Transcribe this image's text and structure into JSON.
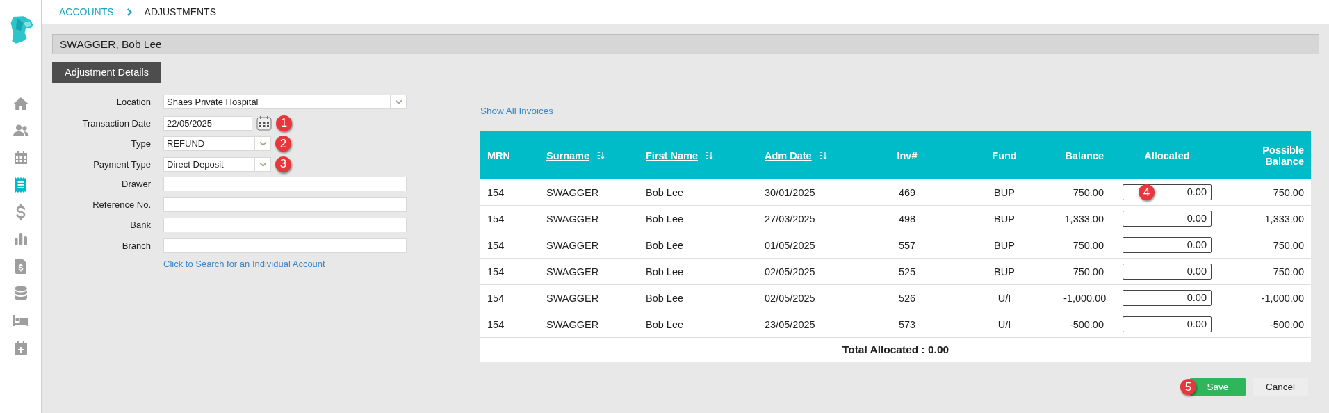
{
  "sidebar": {
    "items": [
      {
        "kind": "home",
        "selected": false
      },
      {
        "kind": "users",
        "selected": false
      },
      {
        "kind": "calendar",
        "selected": false
      },
      {
        "kind": "receipt",
        "selected": true
      },
      {
        "kind": "dollar",
        "selected": false
      },
      {
        "kind": "chart",
        "selected": false
      },
      {
        "kind": "invoice",
        "selected": false
      },
      {
        "kind": "database",
        "selected": false
      },
      {
        "kind": "bed",
        "selected": false
      },
      {
        "kind": "calendar-plus",
        "selected": false
      }
    ]
  },
  "breadcrumb": [
    {
      "label": "ACCOUNTS",
      "kind": "link"
    },
    {
      "label": "ADJUSTMENTS",
      "kind": "current"
    }
  ],
  "patient_name": "SWAGGER, Bob Lee",
  "tabs": [
    {
      "label": "Adjustment Details",
      "selected": true
    }
  ],
  "form": {
    "fields": [
      {
        "label": "Location",
        "kind": "wide-select",
        "value": "Shaes Private Hospital"
      },
      {
        "label": "Transaction Date",
        "kind": "date",
        "value": "22/05/2025",
        "marker": "1"
      },
      {
        "label": "Type",
        "kind": "select",
        "value": "REFUND",
        "marker": "2"
      },
      {
        "label": "Payment Type",
        "kind": "select",
        "value": "Direct Deposit",
        "marker": "3"
      },
      {
        "label": "Drawer",
        "kind": "text"
      },
      {
        "label": "Reference No.",
        "kind": "text"
      },
      {
        "label": "Bank",
        "kind": "text"
      },
      {
        "label": "Branch",
        "kind": "text"
      }
    ],
    "search_link": "Click to Search for an Individual Account"
  },
  "show_all_link": "Show All Invoices",
  "table": {
    "columns": [
      {
        "label": "MRN",
        "sortable": false
      },
      {
        "label": "Surname",
        "sortable": true
      },
      {
        "label": "First Name",
        "sortable": true
      },
      {
        "label": "Adm Date",
        "sortable": true
      },
      {
        "label": "Inv#",
        "sortable": false
      },
      {
        "label": "Fund",
        "sortable": false
      },
      {
        "label": "Balance",
        "sortable": false
      },
      {
        "label": "Allocated",
        "sortable": false
      },
      {
        "label": "Possible Balance",
        "sortable": false
      }
    ],
    "rows": [
      {
        "cells": [
          "154",
          "SWAGGER",
          "Bob Lee",
          "30/01/2025",
          "469",
          "BUP",
          "750.00"
        ],
        "allocated": "0.00",
        "possible_balance": "750.00",
        "marker": "4"
      },
      {
        "cells": [
          "154",
          "SWAGGER",
          "Bob Lee",
          "27/03/2025",
          "498",
          "BUP",
          "1,333.00"
        ],
        "allocated": "0.00",
        "possible_balance": "1,333.00"
      },
      {
        "cells": [
          "154",
          "SWAGGER",
          "Bob Lee",
          "01/05/2025",
          "557",
          "BUP",
          "750.00"
        ],
        "allocated": "0.00",
        "possible_balance": "750.00"
      },
      {
        "cells": [
          "154",
          "SWAGGER",
          "Bob Lee",
          "02/05/2025",
          "525",
          "BUP",
          "750.00"
        ],
        "allocated": "0.00",
        "possible_balance": "750.00"
      },
      {
        "cells": [
          "154",
          "SWAGGER",
          "Bob Lee",
          "02/05/2025",
          "526",
          "U/I",
          "-1,000.00"
        ],
        "allocated": "0.00",
        "possible_balance": "-1,000.00"
      },
      {
        "cells": [
          "154",
          "SWAGGER",
          "Bob Lee",
          "23/05/2025",
          "573",
          "U/I",
          "-500.00"
        ],
        "allocated": "0.00",
        "possible_balance": "-500.00"
      }
    ],
    "total": "Total Allocated : 0.00"
  },
  "buttons": [
    {
      "label": "Save",
      "kind": "primary",
      "marker": "5"
    },
    {
      "label": "Cancel",
      "kind": "secondary"
    }
  ]
}
